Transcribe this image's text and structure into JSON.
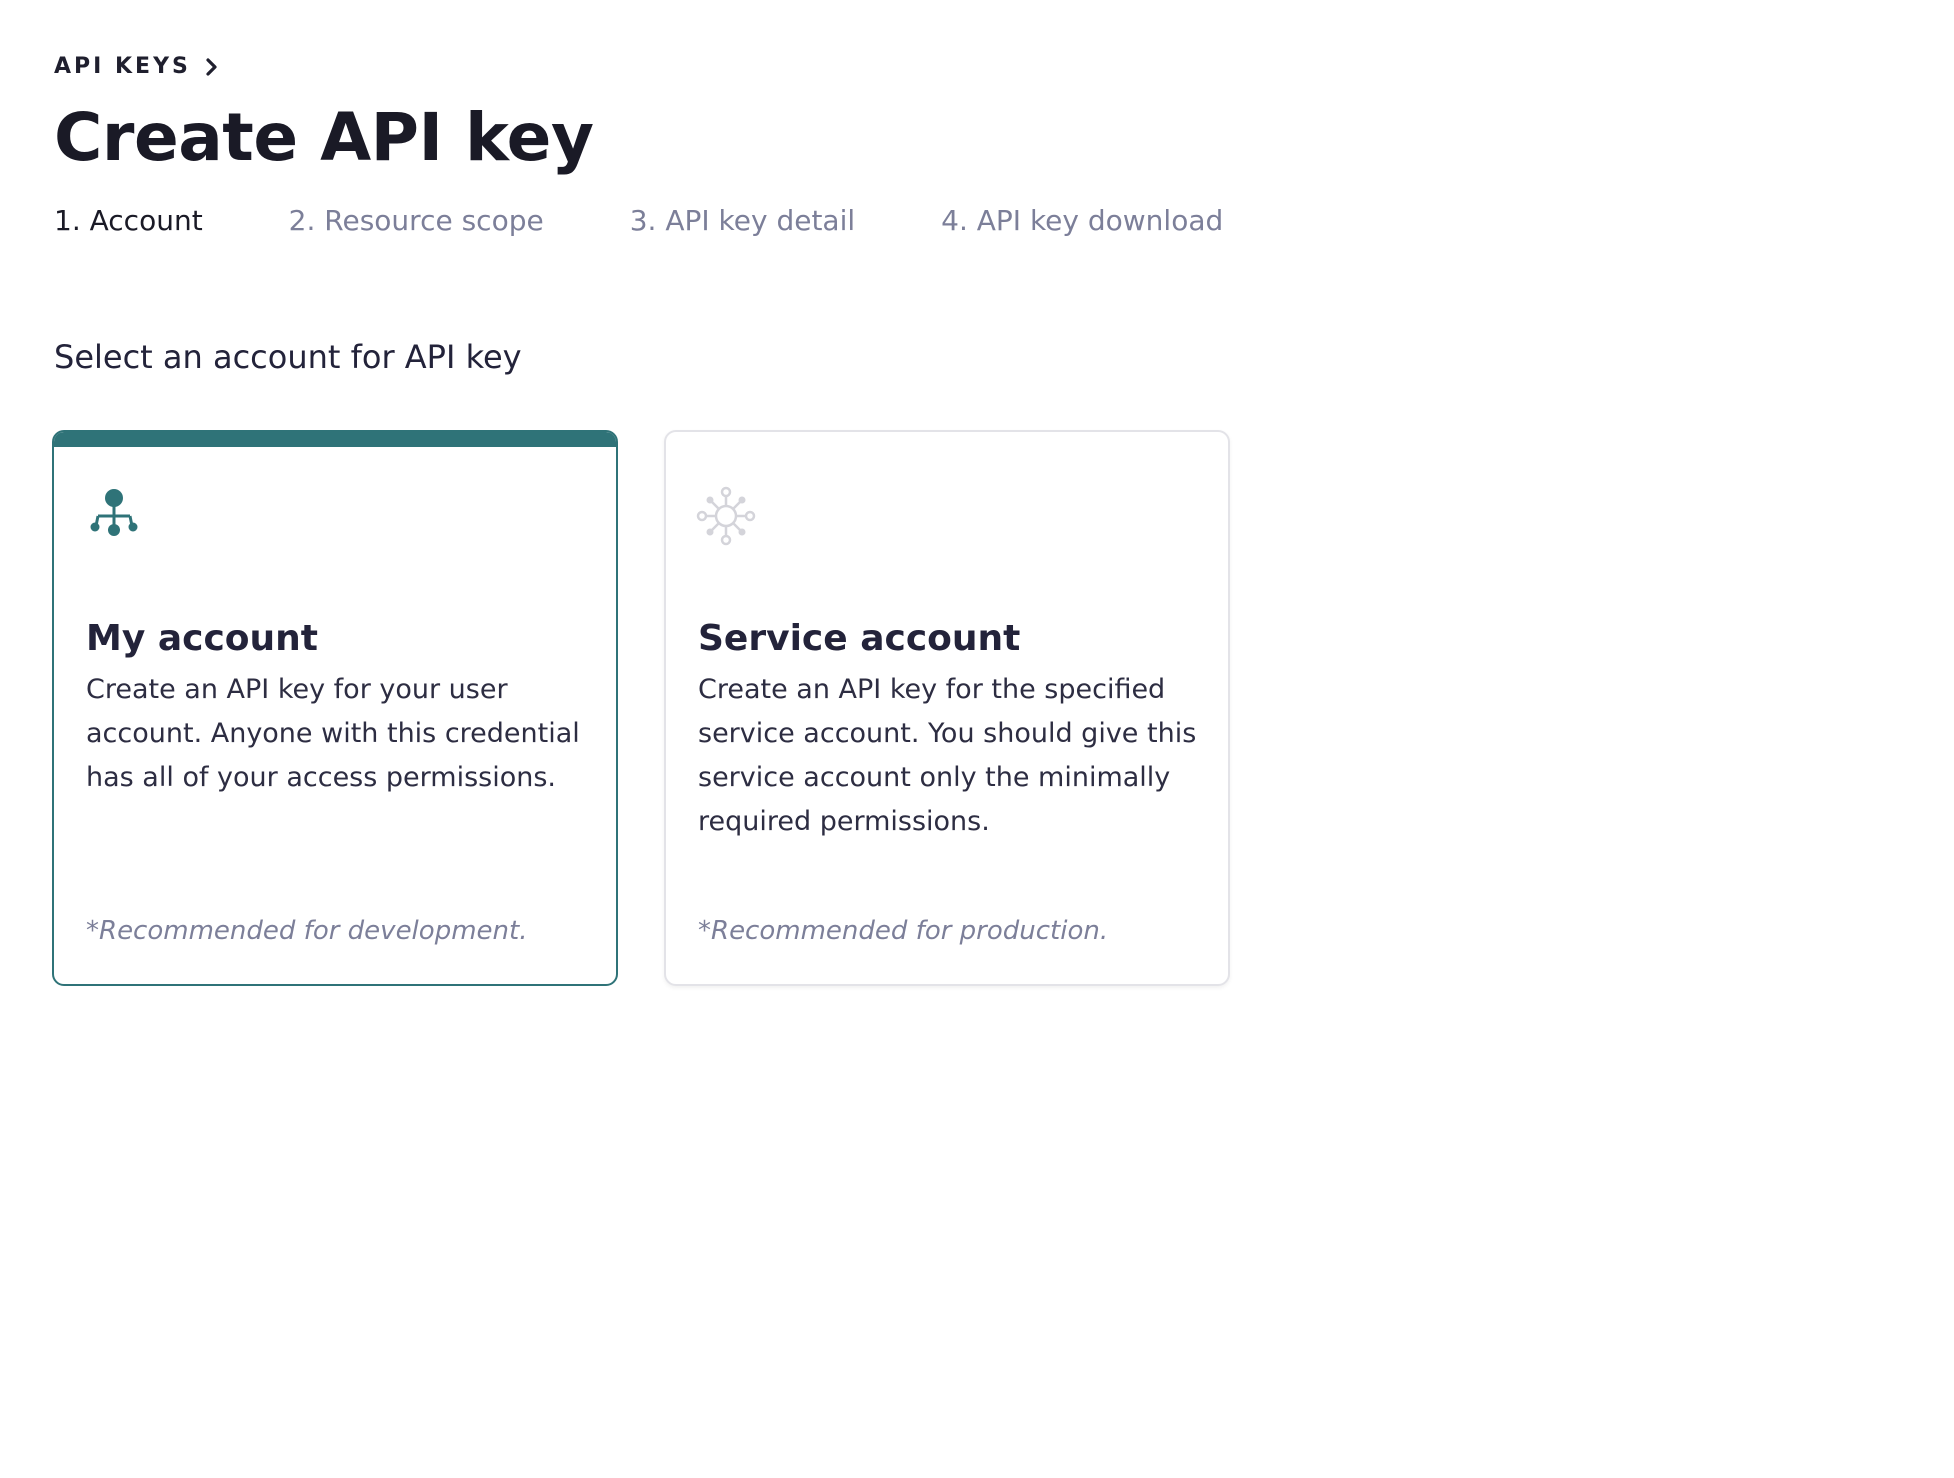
{
  "breadcrumb": {
    "label": "API KEYS",
    "icon": "chevron-right-icon"
  },
  "page_title": "Create API key",
  "steps": [
    {
      "label": "1. Account",
      "active": true
    },
    {
      "label": "2. Resource scope",
      "active": false
    },
    {
      "label": "3. API key detail",
      "active": false
    },
    {
      "label": "4. API key download",
      "active": false
    }
  ],
  "section_title": "Select an account for API key",
  "cards": [
    {
      "icon": "hierarchy-icon",
      "title": "My account",
      "description": "Create an API key for your user account. Anyone with this credential has all of your access permissions.",
      "note": "*Recommended for development.",
      "selected": true
    },
    {
      "icon": "network-hub-icon",
      "title": "Service account",
      "description": "Create an API key for the specified service account. You should give this service account only the minimally required permissions.",
      "note": "*Recommended for production.",
      "selected": false
    }
  ],
  "colors": {
    "accent": "#2f7378",
    "muted_text": "#7c7f99",
    "inactive_icon": "#d4d4da",
    "card_border": "#e3e3e8"
  }
}
